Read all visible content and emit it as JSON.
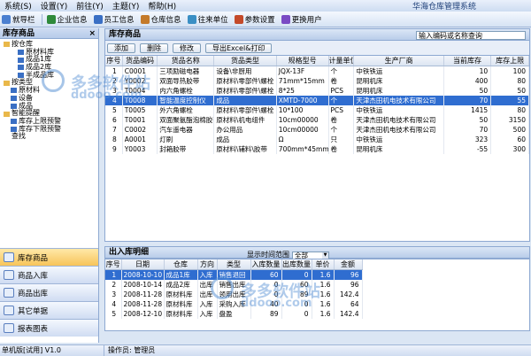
{
  "app": {
    "title": "华海仓库管理系统"
  },
  "menu": [
    {
      "label": "系统(S)"
    },
    {
      "label": "设置(Y)"
    },
    {
      "label": "前往(Y)"
    },
    {
      "label": "主题(Y)"
    },
    {
      "label": "帮助(H)"
    }
  ],
  "toolbar": [
    {
      "label": "就导栏",
      "icon": "navigation-icon",
      "color": "#4a7fd0"
    },
    {
      "label": "企业信息",
      "icon": "company-icon",
      "color": "#2f8a3a"
    },
    {
      "label": "员工信息",
      "icon": "staff-icon",
      "color": "#3a6fc4"
    },
    {
      "label": "仓库信息",
      "icon": "warehouse-icon",
      "color": "#c47a2a"
    },
    {
      "label": "往来单位",
      "icon": "partner-icon",
      "color": "#3a8fc4"
    },
    {
      "label": "参数设置",
      "icon": "settings-icon",
      "color": "#c44a2a"
    },
    {
      "label": "更换用户",
      "icon": "switch-user-icon",
      "color": "#7a4ac4"
    }
  ],
  "left_panel": {
    "title": "库存商品",
    "tree": [
      {
        "label": "按仓库",
        "level": 0,
        "icon": "folder-icon"
      },
      {
        "label": "原材料库",
        "level": 2,
        "icon": "node-icon"
      },
      {
        "label": "成品1库",
        "level": 2,
        "icon": "node-icon"
      },
      {
        "label": "成品2库",
        "level": 2,
        "icon": "node-icon"
      },
      {
        "label": "半成品库",
        "level": 2,
        "icon": "node-icon"
      },
      {
        "label": "按类型",
        "level": 0,
        "icon": "folder-icon"
      },
      {
        "label": "原材料",
        "level": 1,
        "icon": "node-icon"
      },
      {
        "label": "设备",
        "level": 1,
        "icon": "node-icon"
      },
      {
        "label": "成品",
        "level": 1,
        "icon": "node-icon"
      },
      {
        "label": "智能提醒",
        "level": 0,
        "icon": "folder-icon"
      },
      {
        "label": "库存上限预警",
        "level": 1,
        "icon": "node-icon"
      },
      {
        "label": "库存下限预警",
        "level": 1,
        "icon": "node-icon"
      },
      {
        "label": "查找",
        "level": 0,
        "icon": "search-icon"
      }
    ],
    "nav": [
      {
        "label": "库存商品",
        "active": true
      },
      {
        "label": "商品入库",
        "active": false
      },
      {
        "label": "商品出库",
        "active": false
      },
      {
        "label": "其它单据",
        "active": false
      },
      {
        "label": "报表图表",
        "active": false
      }
    ]
  },
  "stock": {
    "title": "库存商品",
    "search_placeholder": "输入编码或名称查询",
    "buttons": [
      "添加",
      "删除",
      "修改",
      "导出Excel&打印"
    ],
    "columns": [
      "序号",
      "货品编码",
      "货品名称",
      "货品类型",
      "规格型号",
      "计量单位",
      "生产厂商",
      "当前库存",
      "库存上限"
    ],
    "rows": [
      [
        "1",
        "C0001",
        "三项励磁电器",
        "设备\\非厨用",
        "JQX-13F",
        "个",
        "中铁铁运",
        "10",
        "100"
      ],
      [
        "2",
        "Y0002",
        "双面导热胶带",
        "原材料\\零部件\\螺栓",
        "71mm*15mm",
        "卷",
        "昆明机床",
        "400",
        "80"
      ],
      [
        "3",
        "T0004",
        "内六角螺栓",
        "原材料\\零部件\\螺栓",
        "8*25",
        "PCS",
        "昆明机床",
        "50",
        "50"
      ],
      [
        "4",
        "T0008",
        "智能温度控制仪",
        "成品",
        "XMTD-7000",
        "个",
        "天津杰田机电技术有限公司",
        "70",
        "55"
      ],
      [
        "5",
        "T0005",
        "外六角螺栓",
        "原材料\\零部件\\螺栓",
        "10*100",
        "PCS",
        "中铁铁运",
        "1415",
        "80"
      ],
      [
        "6",
        "T0001",
        "双面聚氨酯泡棉胶带",
        "原材料\\机电组件",
        "10cm00000",
        "卷",
        "天津杰田机电技术有限公司",
        "50",
        "3150"
      ],
      [
        "7",
        "C0002",
        "汽车遥电器",
        "办公用品",
        "10cm00000",
        "个",
        "天津杰田机电技术有限公司",
        "70",
        "500"
      ],
      [
        "8",
        "A0001",
        "灯刷",
        "成品",
        "Ω",
        "只",
        "中铁铁运",
        "323",
        "60"
      ],
      [
        "9",
        "Y0003",
        "封箱胶带",
        "原材料\\辅料\\胶带",
        "700mm*45mm",
        "卷",
        "昆明机床",
        "-55",
        "300"
      ]
    ],
    "selected_row": 3
  },
  "io_detail": {
    "title": "出入库明细",
    "range_label": "显示时间范围",
    "range_value": "全部",
    "columns": [
      "序号",
      "日期",
      "仓库",
      "方向",
      "类型",
      "入库数量",
      "出库数量",
      "单价",
      "金额"
    ],
    "rows": [
      [
        "1",
        "2008-10-10",
        "成品1库",
        "入库",
        "销售退回",
        "60",
        "0",
        "1.6",
        "96"
      ],
      [
        "2",
        "2008-10-14",
        "成品2库",
        "出库",
        "销售出库",
        "0",
        "60",
        "1.6",
        "96"
      ],
      [
        "3",
        "2008-11-28",
        "原材料库",
        "出库",
        "领用出库",
        "0",
        "89",
        "1.6",
        "142.4"
      ],
      [
        "4",
        "2008-11-28",
        "原材料库",
        "入库",
        "采购入库",
        "40",
        "0",
        "1.6",
        "64"
      ],
      [
        "5",
        "2008-12-10",
        "原材料库",
        "入库",
        "盘盈",
        "89",
        "0",
        "1.6",
        "142.4"
      ]
    ],
    "selected_row": 0
  },
  "status": {
    "left": "单机版[试用] V1.0",
    "operator_label": "操作员:",
    "operator": "管理员"
  },
  "watermark": {
    "text": "多多软件站",
    "sub": "ddooo.com"
  }
}
